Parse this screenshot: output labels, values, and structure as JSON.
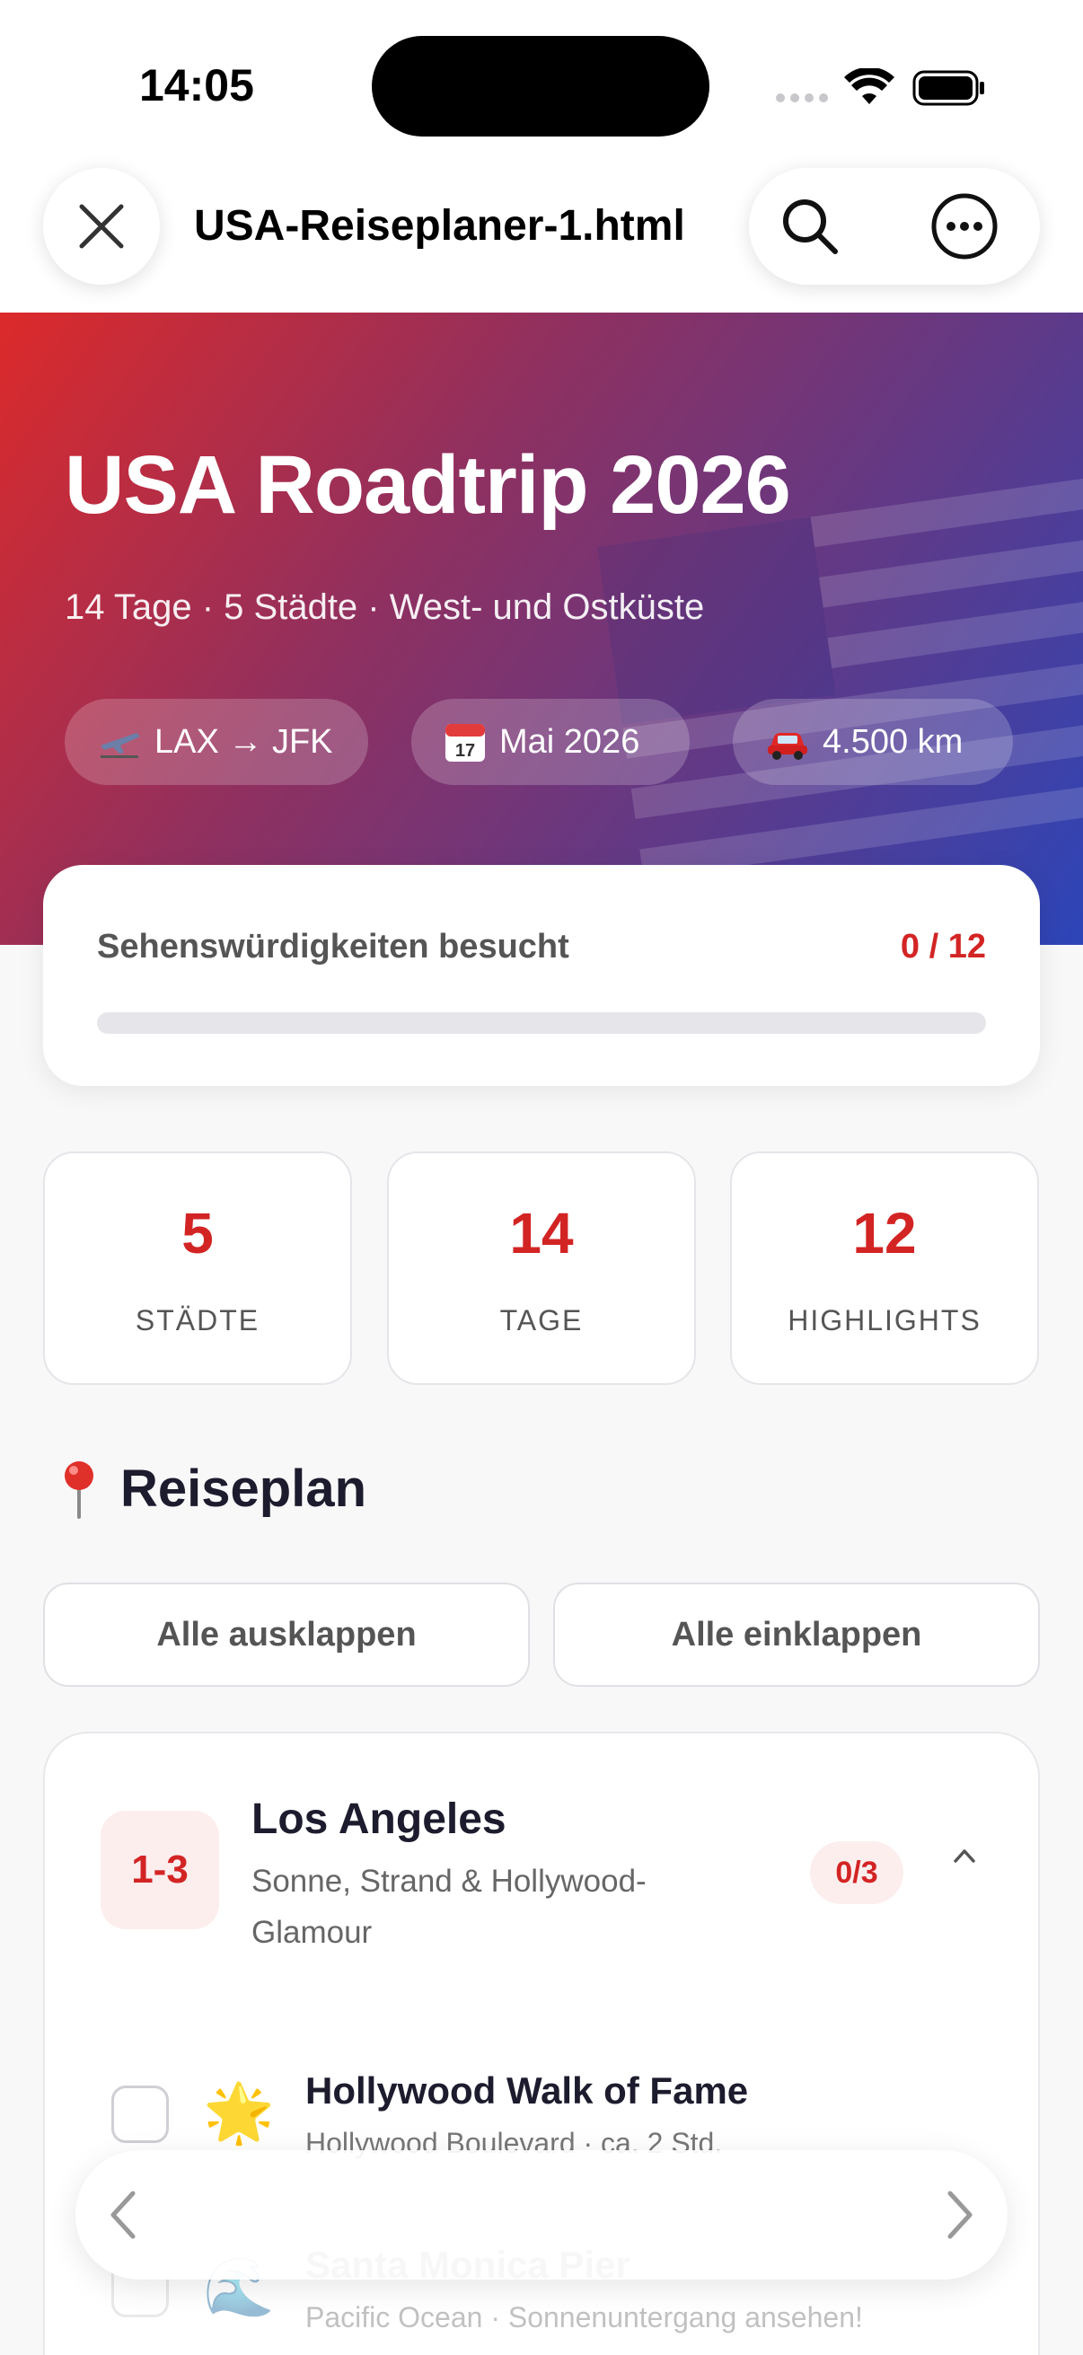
{
  "status_bar": {
    "time": "14:05"
  },
  "browser": {
    "filename": "USA-Reiseplaner-1.html"
  },
  "hero": {
    "title": "USA Roadtrip 2026",
    "subtitle": "14 Tage · 5 Städte · West- und Ostküste",
    "chips": [
      {
        "icon": "airplane-departure-icon",
        "label": "LAX → JFK"
      },
      {
        "icon": "calendar-icon",
        "label": "Mai 2026"
      },
      {
        "icon": "car-icon",
        "label": "4.500 km"
      }
    ]
  },
  "progress": {
    "label": "Sehenswürdigkeiten besucht",
    "count": "0 / 12",
    "fraction": 0
  },
  "stats": [
    {
      "value": "5",
      "label": "STÄDTE"
    },
    {
      "value": "14",
      "label": "TAGE"
    },
    {
      "value": "12",
      "label": "HIGHLIGHTS"
    }
  ],
  "section": {
    "title": "Reiseplan",
    "icon": "pushpin-icon"
  },
  "controls": {
    "expand_all": "Alle ausklappen",
    "collapse_all": "Alle einklappen"
  },
  "city": {
    "days": "1-3",
    "name": "Los Angeles",
    "description": "Sonne, Strand & Hollywood-Glamour",
    "count": "0/3",
    "points_of_interest": [
      {
        "emoji": "🌟",
        "name": "Hollywood Walk of Fame",
        "meta": "Hollywood Boulevard · ca. 2 Std.",
        "checked": false
      },
      {
        "emoji": "🌊",
        "name": "Santa Monica Pier",
        "meta": "Pacific Ocean · Sonnenuntergang ansehen!",
        "checked": false
      }
    ]
  },
  "colors": {
    "accent": "#d32424",
    "hero_gradient_start": "#dc2a2a",
    "hero_gradient_end": "#2c45b8"
  }
}
